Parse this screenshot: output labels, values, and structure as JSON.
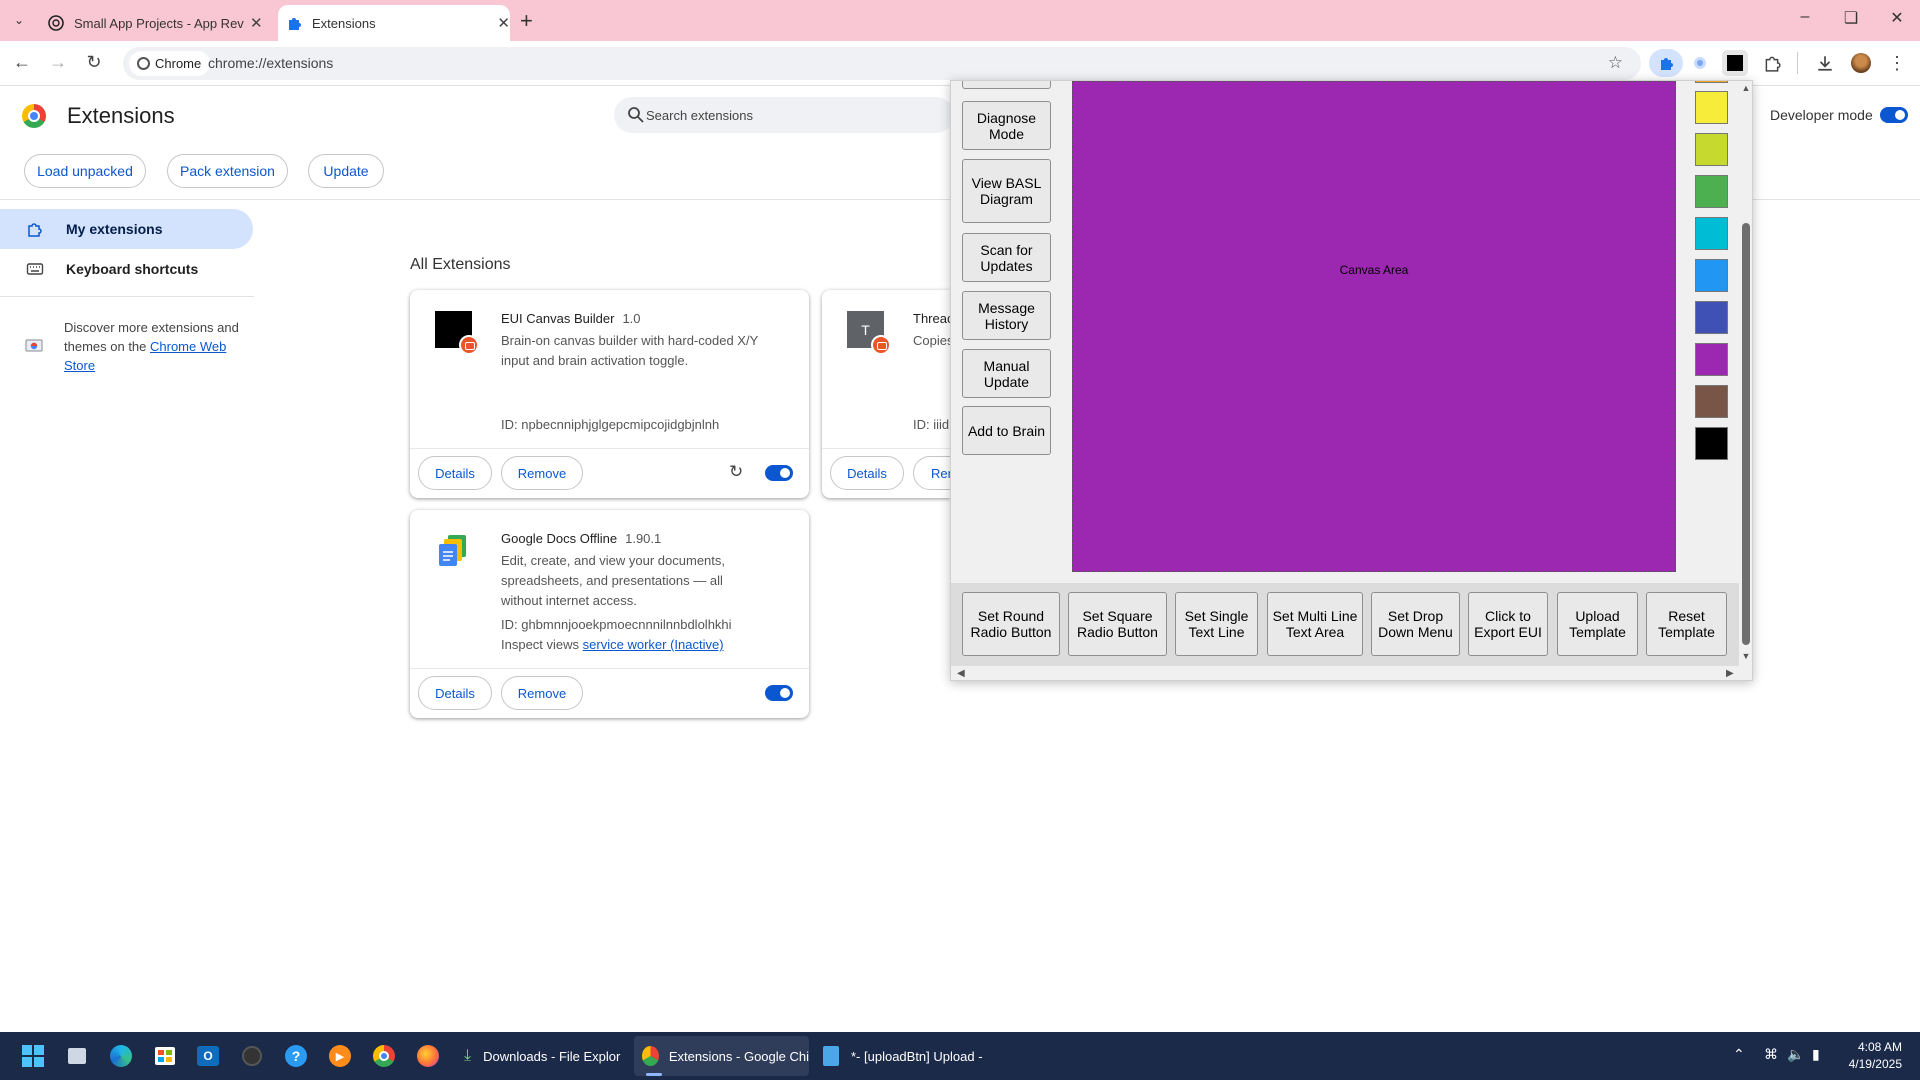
{
  "browser": {
    "tabs": [
      {
        "title": "Small App Projects - App Revie"
      },
      {
        "title": "Extensions"
      }
    ],
    "omnibox": {
      "chip_label": "Chrome",
      "url": "chrome://extensions"
    }
  },
  "page": {
    "title": "Extensions",
    "search_placeholder": "Search extensions",
    "developer_mode_label": "Developer mode",
    "developer_mode_on": true,
    "actions": {
      "load_unpacked": "Load unpacked",
      "pack_extension": "Pack extension",
      "update": "Update"
    },
    "sidebar": {
      "my_extensions": "My extensions",
      "keyboard_shortcuts": "Keyboard shortcuts",
      "discover_text": "Discover more extensions and themes on the ",
      "web_store_link": "Chrome Web Store"
    },
    "section_title": "All Extensions",
    "extensions": [
      {
        "name": "EUI Canvas Builder",
        "version": "1.0",
        "description": "Brain-on canvas builder with hard-coded X/Y input and brain activation toggle.",
        "id": "ID: npbecnniphjglgepcmipcojidgbjnlnh",
        "details": "Details",
        "remove": "Remove",
        "enabled": true
      },
      {
        "name": "Threac",
        "description": "Copies",
        "id": "ID: iiid",
        "details": "Details",
        "remove": "Rem",
        "icon_letter": "T"
      },
      {
        "name": "Google Docs Offline",
        "version": "1.90.1",
        "description": "Edit, create, and view your documents, spreadsheets, and presentations — all without internet access.",
        "id": "ID: ghbmnnjooekpmoecnnnilnnbdlolhkhi",
        "inspect_label": "Inspect views ",
        "inspect_link": "service worker (Inactive)",
        "details": "Details",
        "remove": "Remove",
        "enabled": true
      }
    ]
  },
  "popup": {
    "side_buttons": [
      "Diagnose Mode",
      "View BASL Diagram",
      "Scan for Updates",
      "Message History",
      "Manual Update",
      "Add to Brain"
    ],
    "canvas_label": "Canvas Area",
    "canvas_color": "#9c27b0",
    "swatches": [
      "#f7ec3a",
      "#c6d92e",
      "#4caf50",
      "#00bcd4",
      "#2196f3",
      "#3f51b5",
      "#9c27b0",
      "#795548",
      "#000000"
    ],
    "bottom_buttons": [
      "Set Round Radio Button",
      "Set Square Radio Button",
      "Set Single Text Line",
      "Set Multi Line Text Area",
      "Set Drop Down Menu",
      "Click to Export EUI",
      "Upload Template",
      "Reset Template"
    ]
  },
  "taskbar": {
    "apps": [
      {
        "label": "Downloads - File Explor"
      },
      {
        "label": "Extensions - Google Chi"
      },
      {
        "label": "*- [uploadBtn] Upload -"
      }
    ],
    "time": "4:08 AM",
    "date": "4/19/2025"
  }
}
